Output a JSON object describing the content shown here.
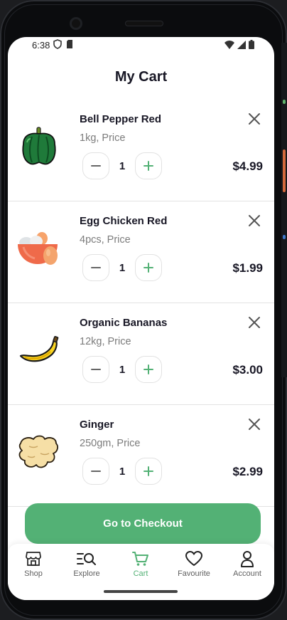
{
  "status_bar": {
    "time": "6:38"
  },
  "header": {
    "title": "My Cart"
  },
  "cart_items": [
    {
      "name": "Bell Pepper Red",
      "description": "1kg, Price",
      "quantity": "1",
      "price": "$4.99",
      "icon": "bell-pepper"
    },
    {
      "name": "Egg Chicken Red",
      "description": "4pcs, Price",
      "quantity": "1",
      "price": "$1.99",
      "icon": "eggs-bowl"
    },
    {
      "name": "Organic Bananas",
      "description": "12kg, Price",
      "quantity": "1",
      "price": "$3.00",
      "icon": "banana"
    },
    {
      "name": "Ginger",
      "description": "250gm, Price",
      "quantity": "1",
      "price": "$2.99",
      "icon": "ginger"
    }
  ],
  "checkout": {
    "label": "Go to Checkout"
  },
  "tabs": [
    {
      "label": "Shop",
      "icon": "store-icon"
    },
    {
      "label": "Explore",
      "icon": "explore-icon"
    },
    {
      "label": "Cart",
      "icon": "cart-icon",
      "active": true
    },
    {
      "label": "Favourite",
      "icon": "heart-icon"
    },
    {
      "label": "Account",
      "icon": "person-icon"
    }
  ],
  "colors": {
    "accent": "#53b175",
    "text": "#181725",
    "muted": "#7c7c7c",
    "border": "#e2e2e2"
  }
}
